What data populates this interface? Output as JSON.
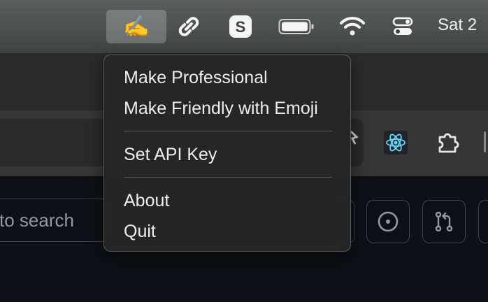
{
  "menubar": {
    "app_icon_glyph": "✍️",
    "icons": [
      "writing-hand-icon",
      "link-icon",
      "s-app-icon",
      "battery-icon",
      "wifi-icon",
      "control-center-icon"
    ],
    "s_letter": "S",
    "clock": "Sat 2"
  },
  "browser": {
    "extensions": [
      "react-devtools-icon",
      "puzzle-extensions-icon"
    ]
  },
  "github": {
    "search_placeholder": "to search",
    "buttons": [
      "issues-icon",
      "pull-requests-icon"
    ]
  },
  "menu": {
    "items": [
      {
        "label": "Make Professional"
      },
      {
        "label": "Make Friendly with Emoji"
      },
      {
        "label": "Set API Key"
      },
      {
        "label": "About"
      },
      {
        "label": "Quit"
      }
    ]
  },
  "colors": {
    "menu_bg": "#262626",
    "react_blue": "#61dafb",
    "page_bg": "#0d1117"
  }
}
